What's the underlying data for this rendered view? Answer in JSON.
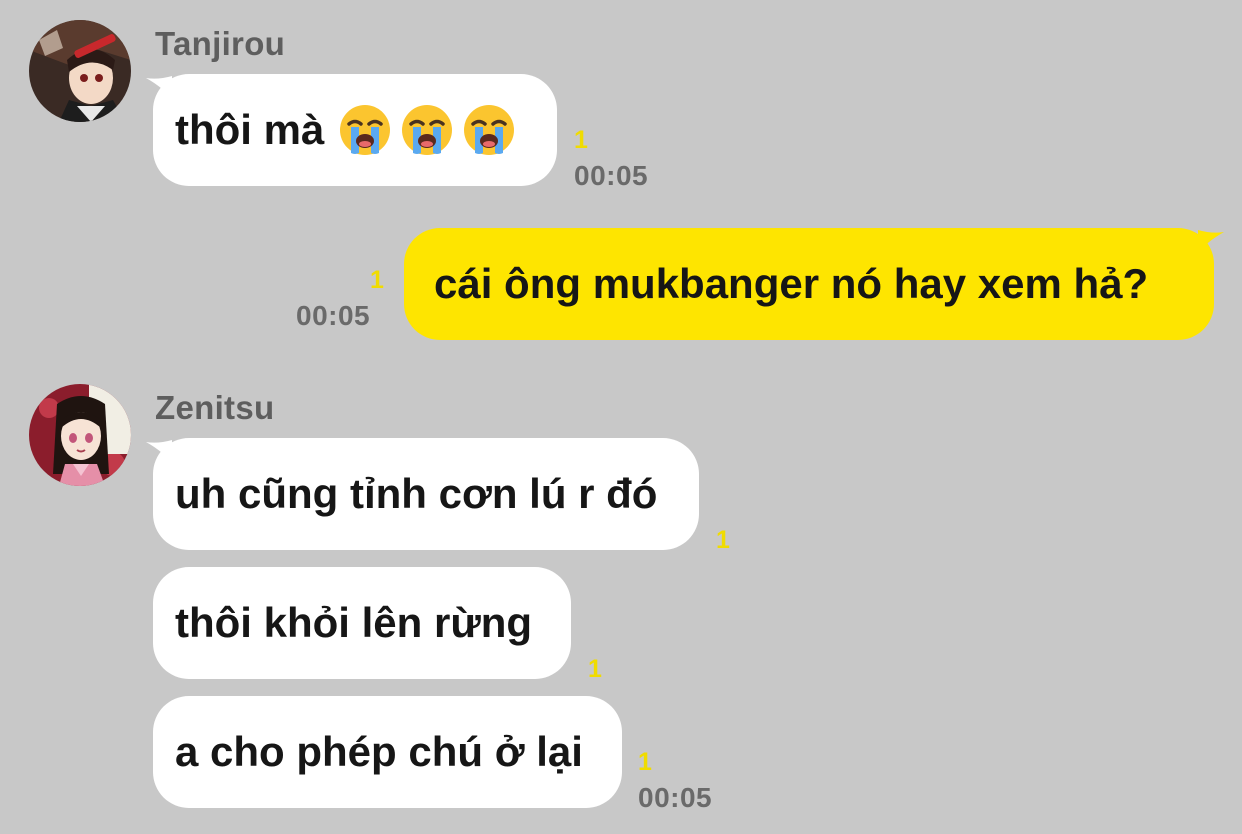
{
  "colors": {
    "background": "#c8c8c8",
    "incoming_bubble": "#ffffff",
    "outgoing_bubble": "#fee500",
    "unread_count": "#f0dc00",
    "timestamp": "#6a6a6a"
  },
  "messages": [
    {
      "group": "tanjirou",
      "sender": "Tanjirou",
      "avatar_icon": "anime-avatar-icon",
      "text": "thôi mà",
      "emoji": [
        "loudly-crying-face-icon",
        "loudly-crying-face-icon",
        "loudly-crying-face-icon"
      ],
      "unread": "1",
      "time": "00:05"
    },
    {
      "group": "me",
      "text": "cái ông mukbanger nó hay xem hả?",
      "unread": "1",
      "time": "00:05"
    },
    {
      "group": "zenitsu",
      "sender": "Zenitsu",
      "avatar_icon": "anime-avatar-icon",
      "items": [
        {
          "text": "uh cũng tỉnh cơn lú r đó",
          "unread": "1"
        },
        {
          "text": "thôi khỏi lên rừng",
          "unread": "1"
        },
        {
          "text": "a cho phép chú ở lại",
          "unread": "1",
          "time": "00:05"
        }
      ]
    }
  ]
}
